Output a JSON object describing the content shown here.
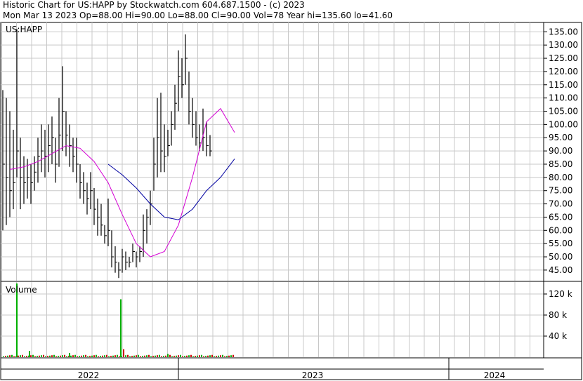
{
  "header": {
    "line1": "Historic Chart for US:HAPP by Stockwatch.com 604.687.1500 - (c) 2023",
    "line2": "Mon Mar 13 2023  Op=88.00  Hi=90.00  Lo=88.00  Cl=90.00  Vol=78  Year hi=135.60  lo=41.60"
  },
  "price_panel": {
    "symbol_label": "US:HAPP"
  },
  "volume_panel": {
    "label": "Volume"
  },
  "chart_data": [
    {
      "type": "line",
      "title": "US:HAPP",
      "ylim": [
        41,
        138
      ],
      "yticks": [
        "135.00",
        "130.00",
        "125.00",
        "120.00",
        "115.00",
        "110.00",
        "105.00",
        "100.00",
        "95.00",
        "90.00",
        "85.00",
        "80.00",
        "75.00",
        "70.00",
        "65.00",
        "60.00",
        "55.00",
        "50.00",
        "45.00"
      ],
      "ytick_values": [
        135,
        130,
        125,
        120,
        115,
        110,
        105,
        100,
        95,
        90,
        85,
        80,
        75,
        70,
        65,
        60,
        55,
        50,
        45
      ],
      "x_axis_labels": [
        "2022",
        "2023",
        "2024"
      ],
      "grid": true,
      "series": [
        {
          "color": "#000000",
          "x": [
            0,
            5,
            10,
            15,
            20,
            25,
            30,
            35,
            40,
            45,
            50,
            55,
            60,
            65,
            70,
            75,
            80,
            85,
            90,
            95,
            100,
            105,
            110,
            115,
            120,
            125,
            130,
            135,
            140,
            145,
            150,
            155,
            160,
            165,
            170,
            175,
            180,
            185,
            190,
            195,
            200,
            205,
            210,
            215,
            220,
            225,
            230,
            235,
            240,
            245,
            250,
            255,
            260,
            265,
            270,
            275,
            280,
            285,
            290,
            295,
            300,
            305,
            310,
            315,
            320,
            325,
            330
          ],
          "high": [
            113,
            110,
            105,
            98,
            136,
            95,
            88,
            87,
            85,
            88,
            95,
            100,
            98,
            100,
            103,
            95,
            110,
            122,
            105,
            100,
            95,
            95,
            85,
            82,
            78,
            82,
            76,
            72,
            70,
            62,
            72,
            60,
            54,
            48,
            53,
            52,
            50,
            55,
            52,
            54,
            66,
            68,
            75,
            95,
            110,
            112,
            100,
            98,
            105,
            115,
            128,
            125,
            134,
            120,
            110,
            105,
            100,
            106,
            101,
            96
          ],
          "low": [
            60,
            62,
            65,
            68,
            80,
            68,
            70,
            72,
            70,
            75,
            78,
            82,
            80,
            82,
            85,
            78,
            84,
            90,
            88,
            84,
            82,
            78,
            72,
            70,
            66,
            68,
            62,
            58,
            58,
            55,
            54,
            46,
            44,
            42,
            44,
            45,
            46,
            48,
            46,
            48,
            50,
            55,
            62,
            75,
            80,
            82,
            82,
            88,
            92,
            98,
            105,
            110,
            115,
            100,
            95,
            92,
            90,
            90,
            88,
            88
          ],
          "close": [
            85,
            80,
            75,
            78,
            90,
            80,
            78,
            80,
            78,
            82,
            88,
            90,
            88,
            92,
            95,
            85,
            96,
            105,
            96,
            92,
            88,
            85,
            78,
            75,
            72,
            75,
            68,
            65,
            62,
            58,
            60,
            50,
            48,
            45,
            50,
            48,
            48,
            52,
            50,
            52,
            60,
            65,
            70,
            85,
            95,
            90,
            88,
            92,
            100,
            108,
            118,
            115,
            125,
            105,
            100,
            95,
            93,
            95,
            92,
            90
          ]
        },
        {
          "color": "#d400d4",
          "x": [
            10,
            30,
            50,
            70,
            90,
            110,
            130,
            150,
            170,
            190,
            210,
            230,
            250,
            270,
            290,
            310,
            330
          ],
          "values": [
            83,
            84,
            86,
            89,
            92,
            91,
            86,
            78,
            66,
            55,
            50,
            52,
            62,
            80,
            101,
            106,
            97
          ]
        },
        {
          "color": "#0000a0",
          "x": [
            150,
            170,
            190,
            210,
            230,
            250,
            270,
            290,
            310,
            330
          ],
          "values": [
            85,
            81,
            76,
            70,
            65,
            64,
            68,
            75,
            80,
            87
          ]
        }
      ]
    },
    {
      "type": "bar",
      "title": "Volume",
      "ylim": [
        0,
        140000
      ],
      "yticks": [
        "120 k",
        "80 k",
        "40 k"
      ],
      "ytick_values": [
        120000,
        80000,
        40000
      ],
      "bars": [
        {
          "x": 20,
          "value": 140000,
          "color": "#00b000"
        },
        {
          "x": 38,
          "value": 12000,
          "color": "#00b000"
        },
        {
          "x": 95,
          "value": 8000,
          "color": "#00b000"
        },
        {
          "x": 168,
          "value": 110000,
          "color": "#00b000"
        },
        {
          "x": 172,
          "value": 15000,
          "color": "#cc0000"
        },
        {
          "x": 235,
          "value": 6000,
          "color": "#00b000"
        }
      ],
      "baseline_small_volume": true
    }
  ]
}
